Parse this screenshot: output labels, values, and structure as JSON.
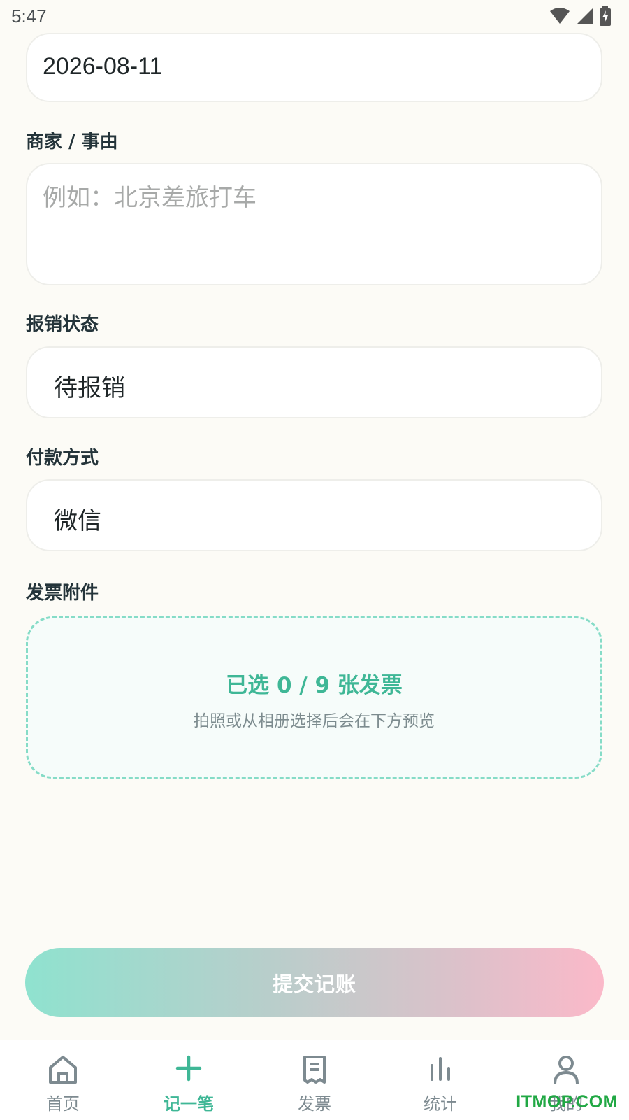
{
  "status_bar": {
    "time": "5:47"
  },
  "form": {
    "date_value": "2026-08-11",
    "merchant_label": "商家 / 事由",
    "merchant_placeholder": "例如：北京差旅打车",
    "reimburse_label": "报销状态",
    "reimburse_value": "待报销",
    "payment_label": "付款方式",
    "payment_value": "微信",
    "attachment_label": "发票附件",
    "attachment_title": "已选 0 / 9 张发票",
    "attachment_hint": "拍照或从相册选择后会在下方预览",
    "submit_label": "提交记账"
  },
  "tabbar": {
    "items": [
      {
        "label": "首页",
        "icon": "home-icon"
      },
      {
        "label": "记一笔",
        "icon": "plus-icon"
      },
      {
        "label": "发票",
        "icon": "receipt-icon"
      },
      {
        "label": "统计",
        "icon": "bar-chart-icon"
      },
      {
        "label": "我的",
        "icon": "user-icon"
      }
    ],
    "active_index": 1
  },
  "watermark": "ITMOP.COM",
  "colors": {
    "accent": "#3fb796",
    "dashed_border": "#86dcc7",
    "background": "#fcfbf6"
  }
}
